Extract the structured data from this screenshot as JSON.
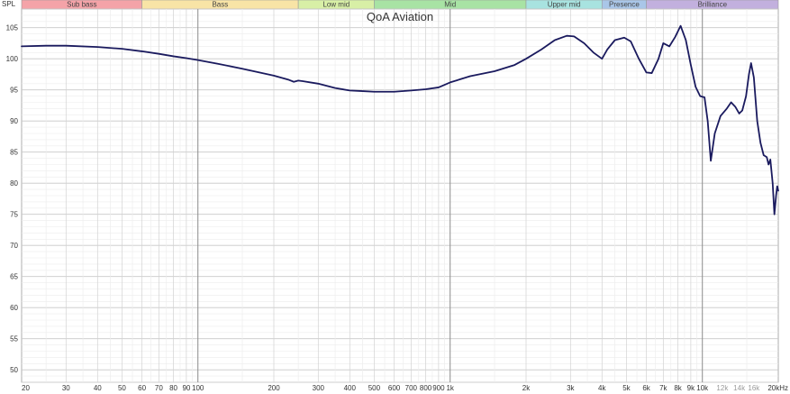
{
  "chart_data": {
    "type": "line",
    "title": "QoA Aviation",
    "ylabel": "SPL",
    "xlabel": "",
    "x_scale": "log",
    "xlim": [
      20,
      20000
    ],
    "ylim": [
      48,
      108
    ],
    "grid": true,
    "y_ticks": [
      50,
      55,
      60,
      65,
      70,
      75,
      80,
      85,
      90,
      95,
      100,
      105
    ],
    "x_ticks": [
      {
        "v": 20,
        "label": "20",
        "style": "major"
      },
      {
        "v": 30,
        "label": "30",
        "style": "major"
      },
      {
        "v": 40,
        "label": "40",
        "style": "major"
      },
      {
        "v": 50,
        "label": "50",
        "style": "major"
      },
      {
        "v": 60,
        "label": "60",
        "style": "major"
      },
      {
        "v": 70,
        "label": "70",
        "style": "major"
      },
      {
        "v": 80,
        "label": "80",
        "style": "major"
      },
      {
        "v": 90,
        "label": "90",
        "style": "major"
      },
      {
        "v": 100,
        "label": "100",
        "style": "major"
      },
      {
        "v": 200,
        "label": "200",
        "style": "major"
      },
      {
        "v": 300,
        "label": "300",
        "style": "major"
      },
      {
        "v": 400,
        "label": "400",
        "style": "major"
      },
      {
        "v": 500,
        "label": "500",
        "style": "major"
      },
      {
        "v": 600,
        "label": "600",
        "style": "major"
      },
      {
        "v": 700,
        "label": "700",
        "style": "major"
      },
      {
        "v": 800,
        "label": "800",
        "style": "major"
      },
      {
        "v": 900,
        "label": "900",
        "style": "major"
      },
      {
        "v": 1000,
        "label": "1k",
        "style": "major"
      },
      {
        "v": 2000,
        "label": "2k",
        "style": "major"
      },
      {
        "v": 3000,
        "label": "3k",
        "style": "major"
      },
      {
        "v": 4000,
        "label": "4k",
        "style": "major"
      },
      {
        "v": 5000,
        "label": "5k",
        "style": "major"
      },
      {
        "v": 6000,
        "label": "6k",
        "style": "major"
      },
      {
        "v": 7000,
        "label": "7k",
        "style": "major"
      },
      {
        "v": 8000,
        "label": "8k",
        "style": "major"
      },
      {
        "v": 9000,
        "label": "9k",
        "style": "major"
      },
      {
        "v": 10000,
        "label": "10k",
        "style": "major"
      },
      {
        "v": 12000,
        "label": "12k",
        "style": "minor"
      },
      {
        "v": 14000,
        "label": "14k",
        "style": "minor"
      },
      {
        "v": 16000,
        "label": "16k",
        "style": "minor"
      },
      {
        "v": 20000,
        "label": "20kHz",
        "style": "major"
      }
    ],
    "bands": [
      {
        "name": "Sub bass",
        "from": 20,
        "to": 60,
        "color": "#f4a3a8"
      },
      {
        "name": "Bass",
        "from": 60,
        "to": 250,
        "color": "#f8e4a6"
      },
      {
        "name": "Low mid",
        "from": 250,
        "to": 500,
        "color": "#d8efa6"
      },
      {
        "name": "Mid",
        "from": 500,
        "to": 2000,
        "color": "#a8e3a4"
      },
      {
        "name": "Upper mid",
        "from": 2000,
        "to": 4000,
        "color": "#a8e3e0"
      },
      {
        "name": "Presence",
        "from": 4000,
        "to": 6000,
        "color": "#a9c6e8"
      },
      {
        "name": "Brilliance",
        "from": 6000,
        "to": 20000,
        "color": "#c2b0de"
      }
    ],
    "series": [
      {
        "color": "#1a1a5e",
        "points": [
          [
            20,
            102
          ],
          [
            25,
            102.1
          ],
          [
            30,
            102.1
          ],
          [
            40,
            101.9
          ],
          [
            50,
            101.6
          ],
          [
            60,
            101.2
          ],
          [
            70,
            100.8
          ],
          [
            80,
            100.4
          ],
          [
            90,
            100.1
          ],
          [
            100,
            99.8
          ],
          [
            120,
            99.2
          ],
          [
            150,
            98.4
          ],
          [
            200,
            97.3
          ],
          [
            230,
            96.6
          ],
          [
            240,
            96.3
          ],
          [
            250,
            96.5
          ],
          [
            260,
            96.4
          ],
          [
            300,
            96.0
          ],
          [
            350,
            95.3
          ],
          [
            400,
            94.9
          ],
          [
            450,
            94.8
          ],
          [
            500,
            94.7
          ],
          [
            600,
            94.7
          ],
          [
            700,
            94.9
          ],
          [
            800,
            95.1
          ],
          [
            900,
            95.4
          ],
          [
            1000,
            96.2
          ],
          [
            1200,
            97.2
          ],
          [
            1500,
            98.0
          ],
          [
            1800,
            99.0
          ],
          [
            2000,
            100.0
          ],
          [
            2300,
            101.5
          ],
          [
            2600,
            103.0
          ],
          [
            2900,
            103.7
          ],
          [
            3100,
            103.6
          ],
          [
            3400,
            102.5
          ],
          [
            3700,
            101.0
          ],
          [
            4000,
            100.0
          ],
          [
            4200,
            101.5
          ],
          [
            4500,
            103.0
          ],
          [
            4900,
            103.4
          ],
          [
            5200,
            102.8
          ],
          [
            5600,
            100.0
          ],
          [
            6000,
            97.8
          ],
          [
            6300,
            97.7
          ],
          [
            6700,
            100.0
          ],
          [
            7000,
            102.5
          ],
          [
            7400,
            102.0
          ],
          [
            7800,
            103.5
          ],
          [
            8200,
            105.3
          ],
          [
            8600,
            103.0
          ],
          [
            9000,
            99.0
          ],
          [
            9400,
            95.5
          ],
          [
            9800,
            94.0
          ],
          [
            10200,
            93.8
          ],
          [
            10500,
            90.0
          ],
          [
            10800,
            83.6
          ],
          [
            11200,
            88.0
          ],
          [
            11800,
            90.8
          ],
          [
            12500,
            92.0
          ],
          [
            13000,
            93.0
          ],
          [
            13500,
            92.3
          ],
          [
            14000,
            91.2
          ],
          [
            14400,
            91.7
          ],
          [
            14900,
            94.0
          ],
          [
            15300,
            97.5
          ],
          [
            15600,
            99.3
          ],
          [
            16000,
            97.0
          ],
          [
            16500,
            90.0
          ],
          [
            17000,
            86.5
          ],
          [
            17500,
            84.5
          ],
          [
            18000,
            84.2
          ],
          [
            18300,
            83.0
          ],
          [
            18600,
            83.8
          ],
          [
            19000,
            80.0
          ],
          [
            19300,
            75.0
          ],
          [
            19600,
            78.0
          ],
          [
            19800,
            79.5
          ],
          [
            20000,
            78.8
          ]
        ]
      }
    ]
  }
}
